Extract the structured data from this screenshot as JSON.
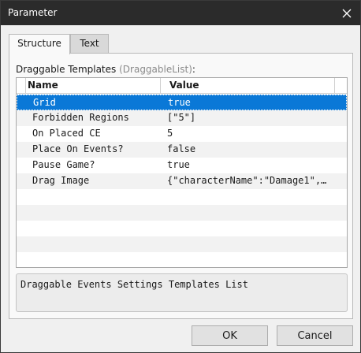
{
  "window": {
    "title": "Parameter"
  },
  "tabs": [
    {
      "label": "Structure",
      "active": true
    },
    {
      "label": "Text",
      "active": false
    }
  ],
  "section": {
    "label": "Draggable Templates",
    "type_hint": "(DraggableList)",
    "suffix": ":"
  },
  "grid": {
    "columns": [
      "Name",
      "Value"
    ],
    "rows": [
      {
        "name": "Grid",
        "value": "true",
        "selected": true
      },
      {
        "name": "Forbidden Regions",
        "value": "[\"5\"]"
      },
      {
        "name": "On Placed CE",
        "value": "5"
      },
      {
        "name": "Place On Events?",
        "value": "false"
      },
      {
        "name": "Pause Game?",
        "value": "true"
      },
      {
        "name": "Drag Image",
        "value": "{\"characterName\":\"Damage1\",…"
      }
    ]
  },
  "description": "Draggable Events Settings Templates List",
  "buttons": {
    "ok": "OK",
    "cancel": "Cancel"
  },
  "colors": {
    "selection": "#0a78d7",
    "titlebar": "#2b2b2b"
  },
  "icons": {
    "close": "close-icon"
  }
}
